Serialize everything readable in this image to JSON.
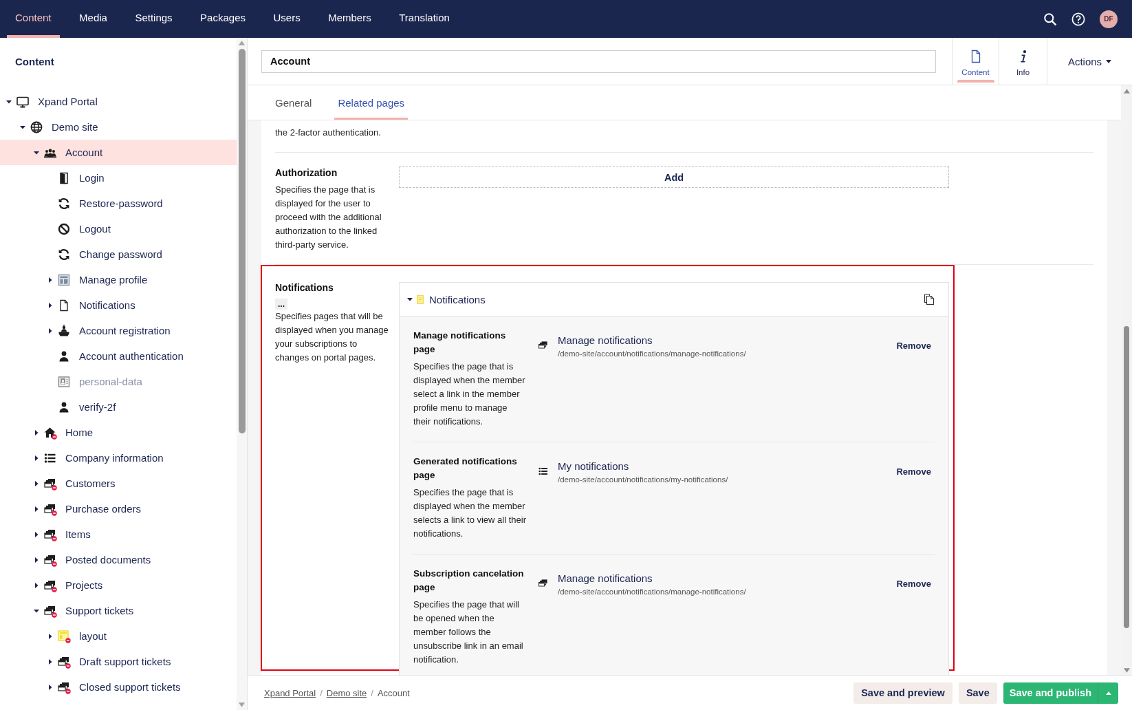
{
  "top_nav": {
    "items": [
      {
        "label": "Content",
        "selected": true
      },
      {
        "label": "Media",
        "selected": false
      },
      {
        "label": "Settings",
        "selected": false
      },
      {
        "label": "Packages",
        "selected": false
      },
      {
        "label": "Users",
        "selected": false
      },
      {
        "label": "Members",
        "selected": false
      },
      {
        "label": "Translation",
        "selected": false
      }
    ],
    "avatar": "DF"
  },
  "sidebar": {
    "title": "Content",
    "tree": [
      {
        "label": "Xpand Portal",
        "kind": "monitor",
        "expanded": true,
        "selected": false,
        "disabled": false,
        "restricted": false,
        "children": [
          {
            "label": "Demo site",
            "kind": "globe",
            "expanded": true,
            "selected": false,
            "disabled": false,
            "restricted": false,
            "children": [
              {
                "label": "Account",
                "kind": "group",
                "expanded": true,
                "selected": true,
                "disabled": false,
                "restricted": false,
                "children": [
                  {
                    "label": "Login",
                    "kind": "door",
                    "selected": false,
                    "disabled": false,
                    "restricted": false
                  },
                  {
                    "label": "Restore-password",
                    "kind": "refresh",
                    "selected": false,
                    "disabled": false,
                    "restricted": false
                  },
                  {
                    "label": "Logout",
                    "kind": "ban",
                    "selected": false,
                    "disabled": false,
                    "restricted": false
                  },
                  {
                    "label": "Change password",
                    "kind": "refresh",
                    "selected": false,
                    "disabled": false,
                    "restricted": false
                  },
                  {
                    "label": "Manage profile",
                    "kind": "layout",
                    "expanded": false,
                    "selected": false,
                    "disabled": false,
                    "restricted": false
                  },
                  {
                    "label": "Notifications",
                    "kind": "file",
                    "expanded": false,
                    "selected": false,
                    "disabled": false,
                    "restricted": false
                  },
                  {
                    "label": "Account registration",
                    "kind": "desk",
                    "expanded": false,
                    "selected": false,
                    "disabled": false,
                    "restricted": false
                  },
                  {
                    "label": "Account authentication",
                    "kind": "person",
                    "selected": false,
                    "disabled": false,
                    "restricted": false
                  },
                  {
                    "label": "personal-data",
                    "kind": "idcard",
                    "selected": false,
                    "disabled": true,
                    "restricted": false
                  },
                  {
                    "label": "verify-2f",
                    "kind": "person",
                    "selected": false,
                    "disabled": false,
                    "restricted": false
                  }
                ]
              },
              {
                "label": "Home",
                "kind": "home",
                "expanded": false,
                "selected": false,
                "disabled": false,
                "restricted": true
              },
              {
                "label": "Company information",
                "kind": "list",
                "expanded": false,
                "selected": false,
                "disabled": false,
                "restricted": false
              },
              {
                "label": "Customers",
                "kind": "stack",
                "expanded": false,
                "selected": false,
                "disabled": false,
                "restricted": true
              },
              {
                "label": "Purchase orders",
                "kind": "stack",
                "expanded": false,
                "selected": false,
                "disabled": false,
                "restricted": true
              },
              {
                "label": "Items",
                "kind": "stack",
                "expanded": false,
                "selected": false,
                "disabled": false,
                "restricted": true
              },
              {
                "label": "Posted documents",
                "kind": "stack",
                "expanded": false,
                "selected": false,
                "disabled": false,
                "restricted": true
              },
              {
                "label": "Projects",
                "kind": "stack",
                "expanded": false,
                "selected": false,
                "disabled": false,
                "restricted": true
              },
              {
                "label": "Support tickets",
                "kind": "stack",
                "expanded": true,
                "selected": false,
                "disabled": false,
                "restricted": true,
                "children": [
                  {
                    "label": "layout",
                    "kind": "template",
                    "expanded": false,
                    "selected": false,
                    "disabled": false,
                    "restricted": true
                  },
                  {
                    "label": "Draft support tickets",
                    "kind": "stack",
                    "expanded": false,
                    "selected": false,
                    "disabled": false,
                    "restricted": true
                  },
                  {
                    "label": "Closed support tickets",
                    "kind": "stack",
                    "expanded": false,
                    "selected": false,
                    "disabled": false,
                    "restricted": true
                  }
                ]
              }
            ]
          }
        ]
      }
    ]
  },
  "editor": {
    "title_field": {
      "value": "Account"
    },
    "view_tabs": [
      {
        "label": "Content",
        "kind": "file",
        "selected": true
      },
      {
        "label": "Info",
        "kind": "info",
        "selected": false
      }
    ],
    "actions": {
      "label": "Actions"
    },
    "tabs": [
      {
        "label": "General",
        "selected": false
      },
      {
        "label": "Related pages",
        "selected": true
      }
    ],
    "sections": [
      {
        "kind": "text",
        "description": "the 2-factor authentication."
      },
      {
        "kind": "empty",
        "label": "Authorization",
        "description": "Specifies the page that is displayed for the user to proceed with the additional authorization to the linked third-party service.",
        "button": "Add"
      },
      {
        "kind": "list",
        "label": "Notifications",
        "more": "...",
        "description": "Specifies pages that will be displayed when you manage your subscriptions to changes on portal pages.",
        "highlighted": true,
        "panel": {
          "title": "Notifications",
          "expanded": true,
          "rows": [
            {
              "label": "Manage notifications page",
              "description": "Specifies the page that is displayed when the member select a link in the member profile menu to manage their notifications.",
              "kind": "stack",
              "page_title": "Manage notifications",
              "path": "/demo-site/account/notifications/manage-notifications/",
              "action": "Remove"
            },
            {
              "label": "Generated notifications page",
              "description": "Specifies the page that is displayed when the member selects a link to view all their notifications.",
              "kind": "list",
              "page_title": "My notifications",
              "path": "/demo-site/account/notifications/my-notifications/",
              "action": "Remove"
            },
            {
              "label": "Subscription cancelation page",
              "description": "Specifies the page that will be opened when the member follows the unsubscribe link in an email notification.",
              "kind": "stack",
              "page_title": "Manage notifications",
              "path": "/demo-site/account/notifications/manage-notifications/",
              "action": "Remove"
            }
          ]
        }
      }
    ]
  },
  "footer": {
    "breadcrumbs": [
      {
        "label": "Xpand Portal",
        "link": true
      },
      {
        "separator": "/",
        "label": "Demo site",
        "link": true
      },
      {
        "separator": "/",
        "label": "Account",
        "link": false
      }
    ],
    "buttons": [
      {
        "label": "Save and preview",
        "kind": "secondary",
        "menu": false
      },
      {
        "label": "Save",
        "kind": "secondary",
        "menu": false
      },
      {
        "label": "Save and publish",
        "kind": "primary",
        "menu": true
      }
    ]
  }
}
